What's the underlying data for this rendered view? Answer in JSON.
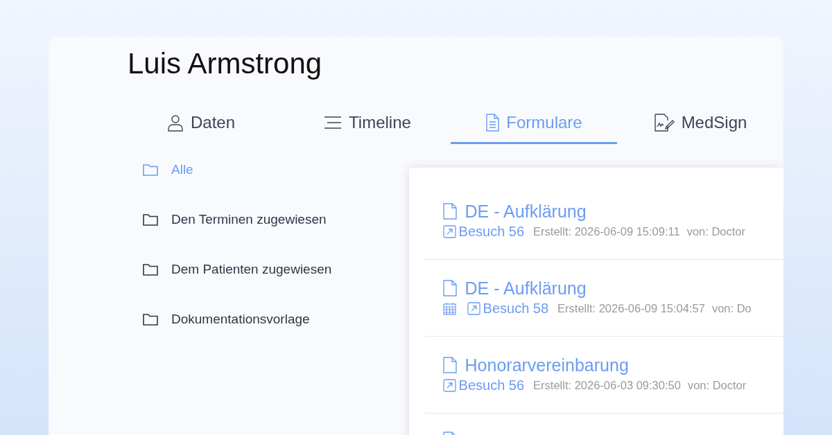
{
  "patient": {
    "name": "Luis Armstrong"
  },
  "tabs": [
    {
      "label": "Daten",
      "kind": "person",
      "selected": false
    },
    {
      "label": "Timeline",
      "kind": "lines",
      "selected": false
    },
    {
      "label": "Formulare",
      "kind": "document",
      "selected": true
    },
    {
      "label": "MedSign",
      "kind": "signature",
      "selected": false
    }
  ],
  "folders": [
    {
      "label": "Alle",
      "selected": true
    },
    {
      "label": "Den Terminen zugewiesen",
      "selected": false
    },
    {
      "label": "Dem Patienten zugewiesen",
      "selected": false
    },
    {
      "label": "Dokumentationsvorlage",
      "selected": false
    }
  ],
  "forms": [
    {
      "title": "DE - Aufklärung",
      "calendar": false,
      "visit": "Besuch 56",
      "created": "Erstellt: 2026-06-09 15:09:11",
      "author": "von: Doctor"
    },
    {
      "title": "DE - Aufklärung",
      "calendar": true,
      "visit": "Besuch 58",
      "created": "Erstellt: 2026-06-09 15:04:57",
      "author": "von: Do"
    },
    {
      "title": "Honorarvereinbarung",
      "calendar": false,
      "visit": "Besuch 56",
      "created": "Erstellt: 2026-06-03 09:30:50",
      "author": "von: Doctor"
    }
  ]
}
